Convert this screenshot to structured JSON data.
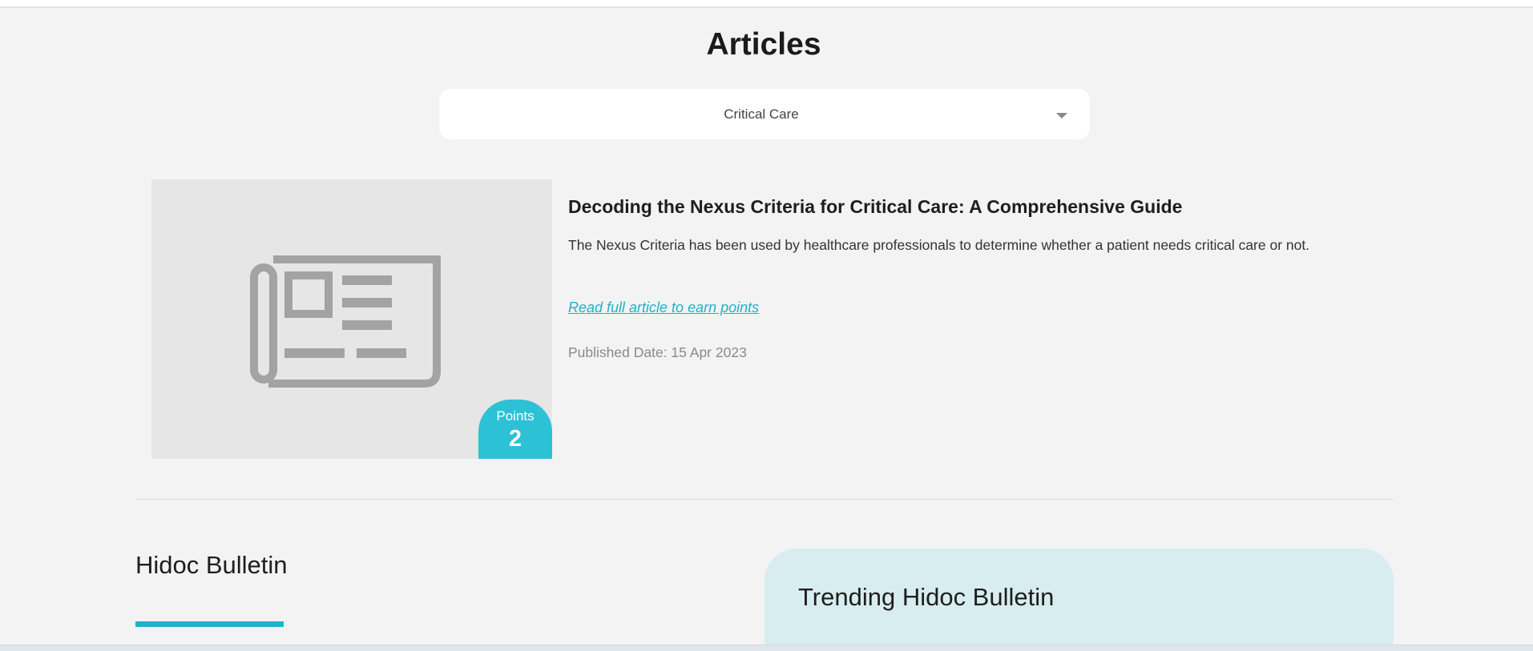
{
  "page": {
    "title": "Articles"
  },
  "filter": {
    "selected": "Critical Care"
  },
  "article": {
    "title": "Decoding the Nexus Criteria for Critical Care: A Comprehensive Guide",
    "description": "The Nexus Criteria has been used by healthcare professionals to determine whether a patient needs critical care or not.",
    "link_label": "Read full article to earn points",
    "published_date": "Published Date: 15 Apr 2023",
    "thumbnail_icon": "newspaper-icon",
    "points_label": "Points",
    "points_value": "2"
  },
  "bulletin": {
    "heading": "Hidoc Bulletin"
  },
  "trending": {
    "title": "Trending Hidoc Bulletin"
  },
  "colors": {
    "accent": "#1fb3c7",
    "badge": "#2dc1d6",
    "background": "#f3f3f3",
    "trending_bg": "#d8edf0"
  }
}
